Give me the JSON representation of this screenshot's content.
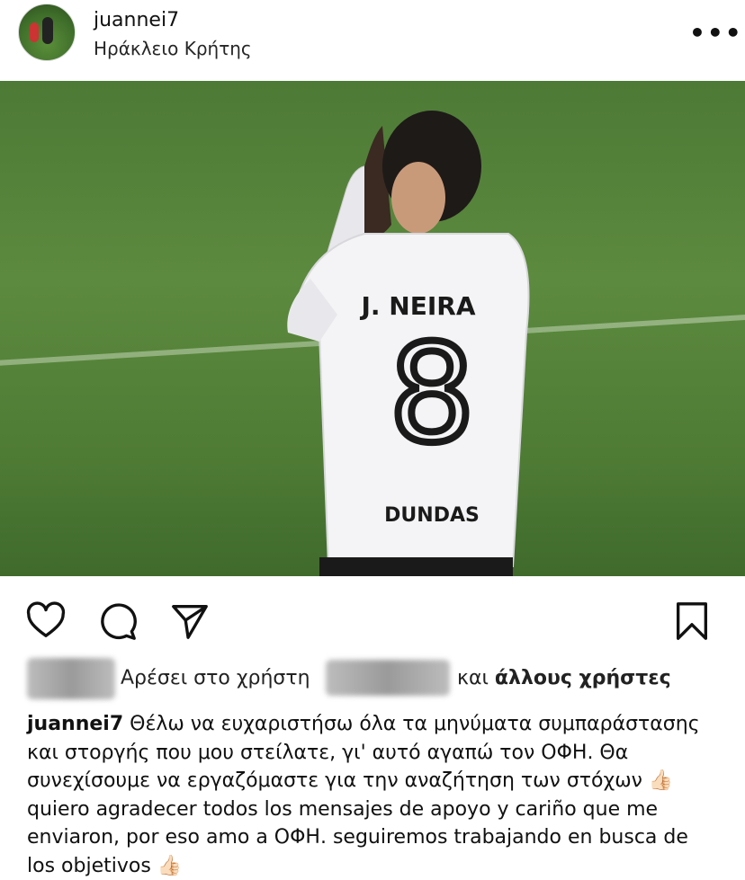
{
  "post": {
    "username": "juannei7",
    "location": "Ηράκλειο Κρήτης",
    "more_icon": "more-horizontal-icon",
    "photo": {
      "jersey_name": "J. NEIRA",
      "jersey_number": "8",
      "sponsor": "DUNDAS"
    },
    "actions": {
      "like_icon": "heart-icon",
      "comment_icon": "comment-icon",
      "share_icon": "send-icon",
      "save_icon": "bookmark-icon"
    },
    "likes": {
      "text": "Αρέσει στο χρήστη",
      "and": "και",
      "others": "άλλους χρήστες"
    },
    "caption": {
      "username": "juannei7",
      "part1": "Θέλω να ευχαριστήσω όλα τα μηνύματα συμπαράστασης και στοργής που μου στείλατε, γι' αυτό αγαπώ τον ΟΦΗ.  Θα συνεχίσουμε να εργαζόμαστε για την αναζήτηση των στόχων",
      "part2": "quiero agradecer todos los mensajes de apoyo y cariño que me enviaron, por eso amo a ΟΦΗ. seguiremos trabajando en busca de los objetivos",
      "emoji": "👍🏻"
    }
  }
}
